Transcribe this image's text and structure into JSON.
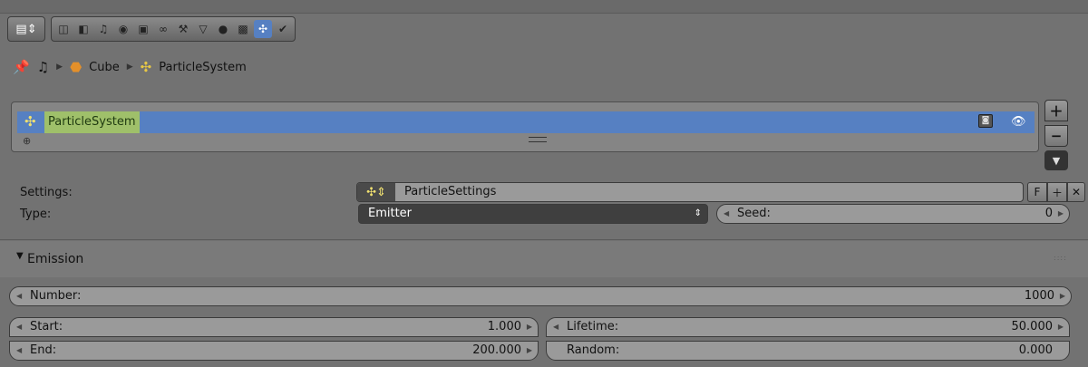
{
  "toolbar": {
    "editor_icon": "editor-type-icon",
    "context_tabs": [
      "render",
      "render-layers",
      "scene",
      "world",
      "object",
      "constraints",
      "modifiers",
      "data",
      "material",
      "texture",
      "particles",
      "physics"
    ],
    "active_tab": "particles"
  },
  "breadcrumb": {
    "object_label": "Cube",
    "system_label": "ParticleSystem"
  },
  "particle_list": {
    "item_label": "ParticleSystem"
  },
  "settings": {
    "settings_label": "Settings:",
    "settings_value": "ParticleSettings",
    "fake_user_label": "F",
    "type_label": "Type:",
    "type_value": "Emitter",
    "seed_label": "Seed:",
    "seed_value": "0"
  },
  "emission": {
    "title": "Emission",
    "number_label": "Number:",
    "number_value": "1000",
    "start_label": "Start:",
    "start_value": "1.000",
    "end_label": "End:",
    "end_value": "200.000",
    "lifetime_label": "Lifetime:",
    "lifetime_value": "50.000",
    "random_label": "Random:",
    "random_value": "0.000"
  },
  "colors": {
    "background": "#727272",
    "selection": "#5680c2",
    "highlight": "#9fc06a"
  }
}
